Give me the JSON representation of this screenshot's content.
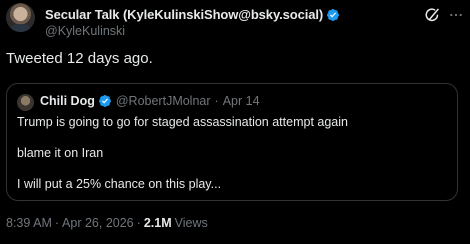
{
  "author": {
    "display_name": "Secular Talk (KyleKulinskiShow@bsky.social)",
    "handle": "@KyleKulinski"
  },
  "tweet": {
    "text": "Tweeted 12 days ago."
  },
  "quoted": {
    "display_name": "Chili Dog",
    "handle": "@RobertJMolnar",
    "separator": "·",
    "date": "Apr 14",
    "lines": [
      "Trump is going to go for staged assassination attempt again",
      "blame it on Iran",
      "I will put a 25% chance on this play..."
    ]
  },
  "footer": {
    "time": "8:39 AM",
    "sep1": "·",
    "date": "Apr 26, 2026",
    "sep2": "·",
    "views_count": "2.1M",
    "views_label": "Views"
  },
  "colors": {
    "background": "#000000",
    "text": "#e7e9ea",
    "muted": "#71767b",
    "verified": "#1d9bf0",
    "border": "#2f3336"
  },
  "icons": [
    "verified-badge-icon",
    "grok-icon",
    "more-options-icon"
  ]
}
